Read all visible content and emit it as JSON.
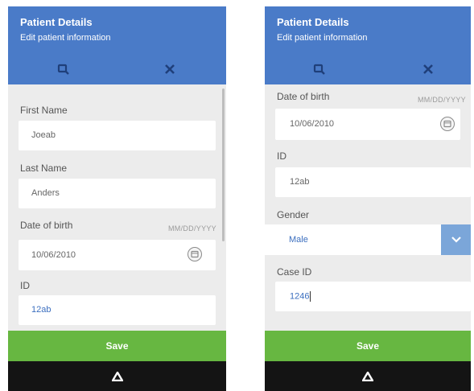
{
  "left": {
    "header": {
      "title": "Patient Details",
      "subtitle": "Edit patient information"
    },
    "fields": {
      "first_name_label": "First Name",
      "first_name_value": "Joeab",
      "last_name_label": "Last Name",
      "last_name_value": "Anders",
      "dob_label": "Date of birth",
      "dob_hint": "MM/DD/YYYY",
      "dob_value": "10/06/2010",
      "id_label": "ID",
      "id_value": "12ab"
    },
    "save_label": "Save"
  },
  "right": {
    "header": {
      "title": "Patient Details",
      "subtitle": "Edit patient information"
    },
    "fields": {
      "dob_label": "Date of birth",
      "dob_hint": "MM/DD/YYYY",
      "dob_value": "10/06/2010",
      "id_label": "ID",
      "id_value": "12ab",
      "gender_label": "Gender",
      "gender_value": "Male",
      "case_id_label": "Case ID",
      "case_id_value": "1246"
    },
    "save_label": "Save"
  },
  "icons": {
    "header_left": "search-icon",
    "header_right": "close-icon",
    "date": "calendar-icon",
    "select": "chevron-down-icon",
    "nav": "home-icon"
  },
  "colors": {
    "header": "#4a7bc8",
    "save": "#67b741",
    "navbar": "#141414",
    "select_button": "#7ba6d9",
    "value_accent": "#3c6fbf"
  }
}
